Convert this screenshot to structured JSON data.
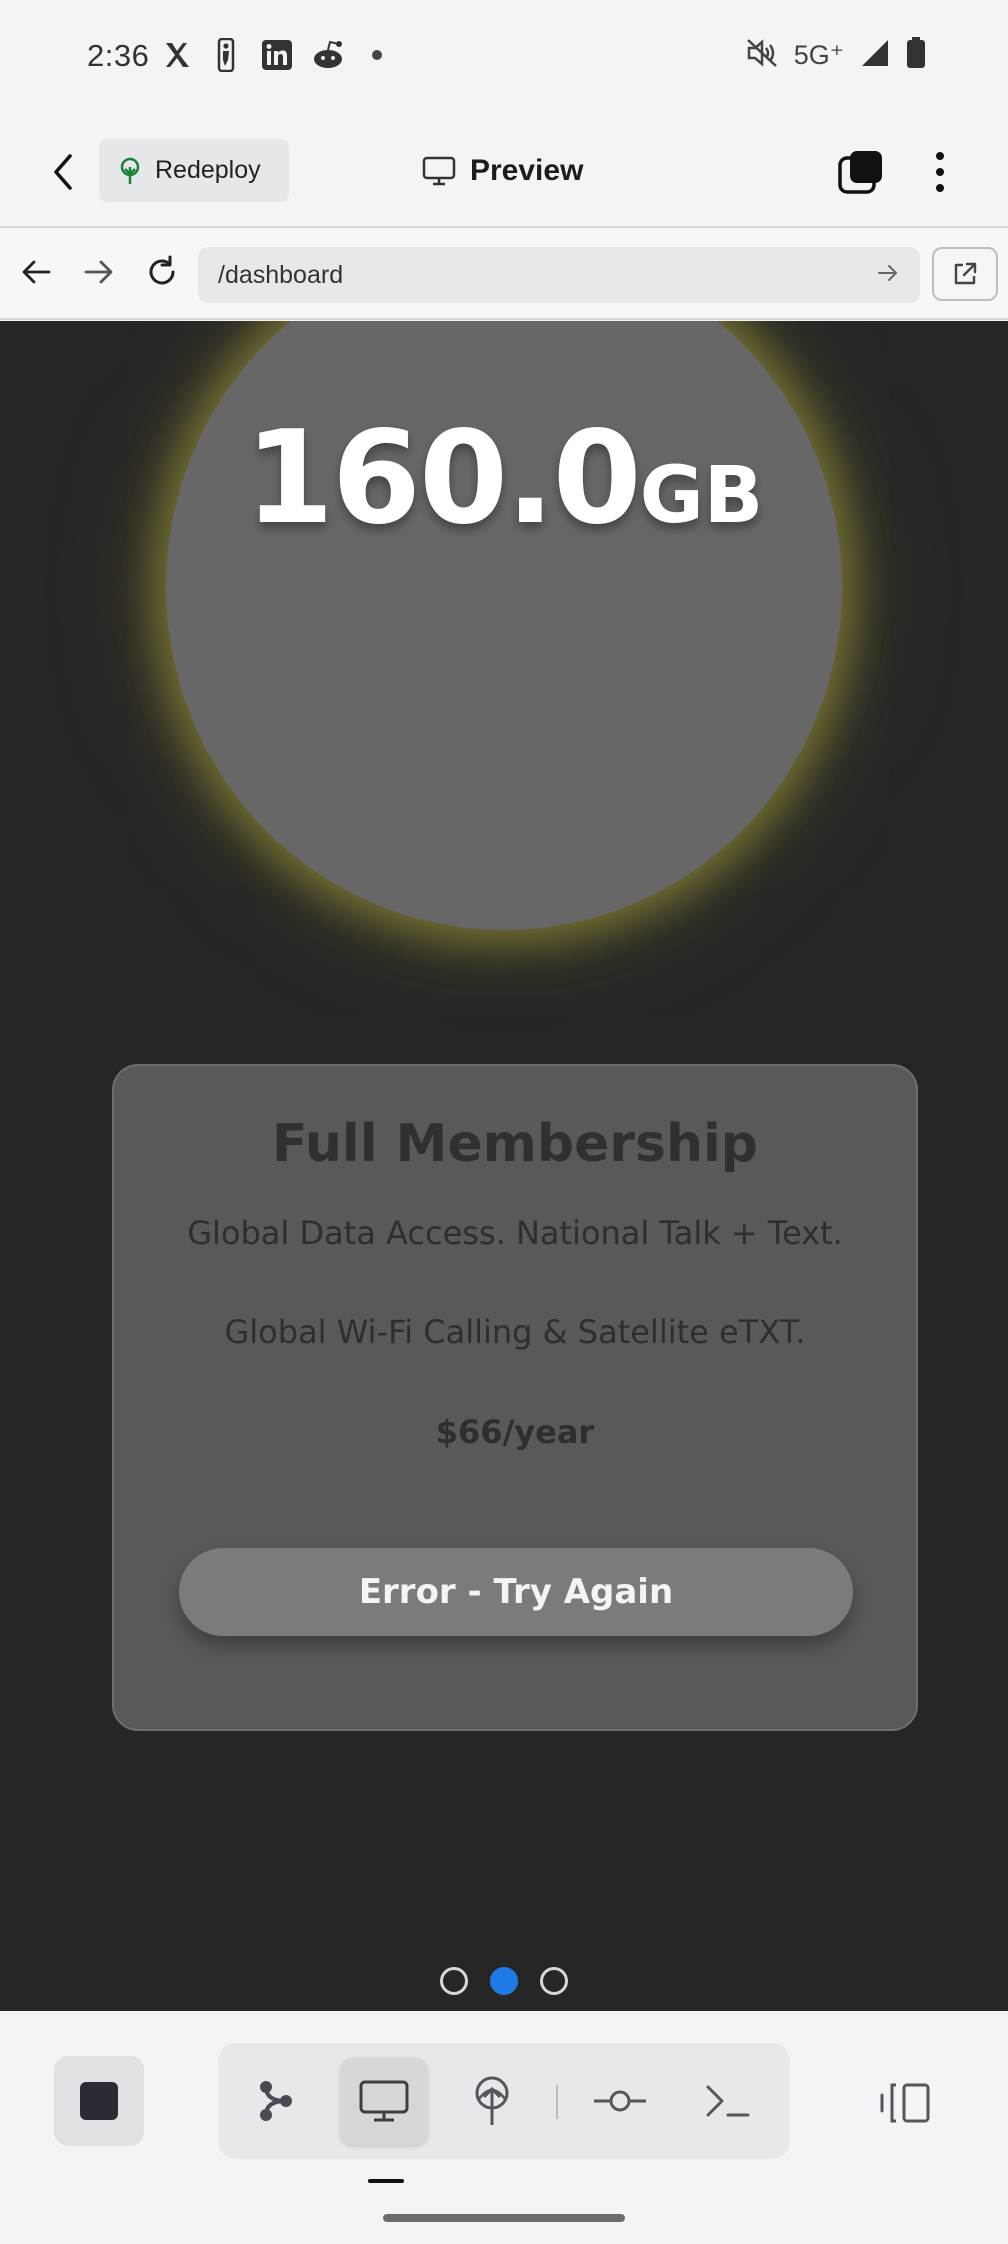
{
  "status_bar": {
    "time": "2:36",
    "notification_icons": [
      "x-icon",
      "nba-icon",
      "linkedin-icon",
      "reddit-icon",
      "dot-icon"
    ],
    "network": "5G⁺",
    "right_icons": [
      "mute-icon",
      "signal-icon",
      "battery-icon"
    ]
  },
  "header": {
    "back_icon": "chevron-left-icon",
    "redeploy_label": "Redeploy",
    "preview_label": "Preview",
    "tabs_icon": "tabs-icon",
    "more_icon": "more-vertical-icon"
  },
  "url_bar": {
    "path": "/dashboard",
    "nav_icons": [
      "arrow-left-icon",
      "arrow-right-icon",
      "refresh-icon"
    ],
    "go_icon": "arrow-right-icon",
    "external_icon": "external-link-icon"
  },
  "preview": {
    "data_value": "160.0",
    "data_unit": "GB",
    "plan": {
      "title": "Full Membership",
      "line1": "Global Data Access. National Talk + Text.",
      "line2": "Global Wi-Fi Calling & Satellite eTXT.",
      "price": "$66/year",
      "button_label": "Error - Try Again"
    },
    "pager": {
      "count": 3,
      "active": 2
    },
    "colors": {
      "accent": "#1f7ae8",
      "glow": "#a8a03c",
      "background": "#262626"
    }
  },
  "toolbar": {
    "stop_icon": "stop-icon",
    "tools": [
      "workflow-icon",
      "monitor-icon",
      "deploy-icon",
      "commit-icon",
      "terminal-icon"
    ],
    "active_tool": "monitor-icon",
    "panels_icon": "panels-icon"
  }
}
